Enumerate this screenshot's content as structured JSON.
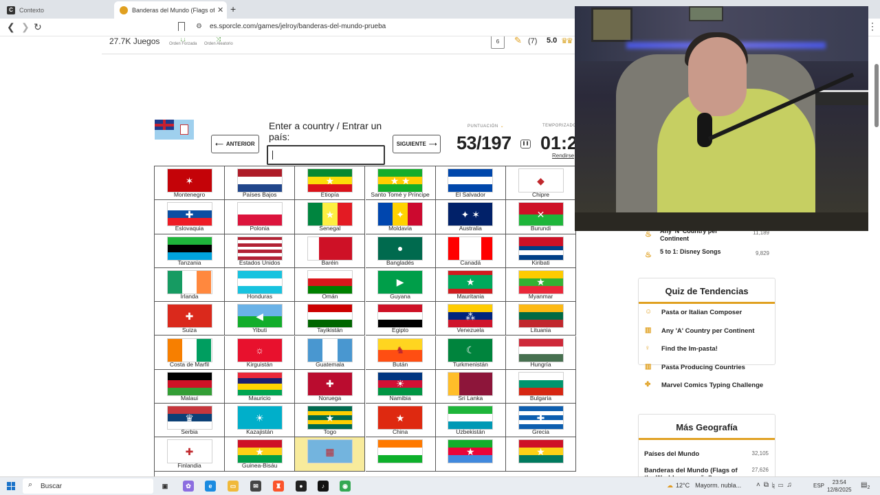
{
  "browser": {
    "tabs": [
      {
        "label": "Contexto",
        "icon": "C",
        "active": false
      },
      {
        "label": "Banderas del Mundo (Flags of the World en español)",
        "icon": "sporcle",
        "active": true
      }
    ],
    "url": "es.sporcle.com/games/jelroy/banderas-del-mundo-prueba"
  },
  "quiz_stats": {
    "plays": "27.7K Juegos",
    "order_forced": "Orden Forzada",
    "order_random": "Orden Aleatorio",
    "comments": "6",
    "ratings_count": "(7)",
    "rating": "5.0"
  },
  "quiz": {
    "answer_label": "Enter a country / Entrar un país:",
    "prev": "ANTERIOR",
    "next": "SIGUIENTE",
    "score_label": "PUNTUACIÓN",
    "score": "53/197",
    "timer_label": "TEMPORIZADOR",
    "timer": "01:2",
    "give_up": "Rendirse"
  },
  "flags": [
    {
      "name": "Montenegro",
      "colors": [
        "#c40308",
        "#c40308"
      ],
      "mark": "✶",
      "dir": "h"
    },
    {
      "name": "Países Bajos",
      "colors": [
        "#ae1c28",
        "#ffffff",
        "#21468b"
      ],
      "dir": "h"
    },
    {
      "name": "Etiopía",
      "colors": [
        "#078930",
        "#fcdd09",
        "#da121a"
      ],
      "mark": "★",
      "dir": "h"
    },
    {
      "name": "Santo Tomé y Príncipe",
      "colors": [
        "#12ad2b",
        "#ffce00",
        "#12ad2b"
      ],
      "mark": "★ ★",
      "dir": "h"
    },
    {
      "name": "El Salvador",
      "colors": [
        "#0047ab",
        "#ffffff",
        "#0047ab"
      ],
      "dir": "h"
    },
    {
      "name": "Chipre",
      "colors": [
        "#ffffff"
      ],
      "mark": "◆",
      "dir": "h"
    },
    {
      "name": "Eslovaquia",
      "colors": [
        "#ffffff",
        "#0b4ea2",
        "#ee1c25"
      ],
      "mark": "✚",
      "dir": "h"
    },
    {
      "name": "Polonia",
      "colors": [
        "#ffffff",
        "#dc143c"
      ],
      "dir": "h"
    },
    {
      "name": "Senegal",
      "colors": [
        "#00853f",
        "#fdef42",
        "#e31b23"
      ],
      "mark": "★",
      "dir": "v"
    },
    {
      "name": "Moldavia",
      "colors": [
        "#0046ae",
        "#ffd200",
        "#cc092f"
      ],
      "mark": "✦",
      "dir": "v"
    },
    {
      "name": "Australia",
      "colors": [
        "#012169",
        "#012169"
      ],
      "mark": "✦ ✶",
      "dir": "h"
    },
    {
      "name": "Burundi",
      "colors": [
        "#ce1126",
        "#1eb53a"
      ],
      "mark": "✕",
      "dir": "h"
    },
    {
      "name": "Tanzania",
      "colors": [
        "#1eb53a",
        "#000000",
        "#00a3dd"
      ],
      "dir": "h"
    },
    {
      "name": "Estados Unidos",
      "colors": [
        "#b22234",
        "#ffffff",
        "#b22234",
        "#ffffff",
        "#b22234",
        "#ffffff",
        "#b22234"
      ],
      "dir": "h"
    },
    {
      "name": "Baréin",
      "colors": [
        "#ffffff",
        "#ce1126",
        "#ce1126",
        "#ce1126"
      ],
      "dir": "v"
    },
    {
      "name": "Bangladés",
      "colors": [
        "#006a4e"
      ],
      "mark": "●",
      "dir": "h"
    },
    {
      "name": "Canadá",
      "colors": [
        "#ff0000",
        "#ffffff",
        "#ffffff",
        "#ff0000"
      ],
      "mark": "✦",
      "dir": "v"
    },
    {
      "name": "Kiribati",
      "colors": [
        "#ce1126",
        "#ce1126",
        "#003f87",
        "#ffffff",
        "#003f87"
      ],
      "dir": "h"
    },
    {
      "name": "Irlanda",
      "colors": [
        "#169b62",
        "#ffffff",
        "#ff883e"
      ],
      "dir": "v"
    },
    {
      "name": "Honduras",
      "colors": [
        "#18c3df",
        "#ffffff",
        "#18c3df"
      ],
      "mark": "∴",
      "dir": "h"
    },
    {
      "name": "Omán",
      "colors": [
        "#ffffff",
        "#db161b",
        "#008000"
      ],
      "dir": "h"
    },
    {
      "name": "Guyana",
      "colors": [
        "#009e49"
      ],
      "mark": "▶",
      "dir": "h"
    },
    {
      "name": "Mauritania",
      "colors": [
        "#d01c1f",
        "#00a95c",
        "#00a95c",
        "#00a95c",
        "#d01c1f"
      ],
      "mark": "★",
      "dir": "h"
    },
    {
      "name": "Myanmar",
      "colors": [
        "#fecb00",
        "#34b233",
        "#ea2839"
      ],
      "mark": "★",
      "dir": "h"
    },
    {
      "name": "Suiza",
      "colors": [
        "#da291c"
      ],
      "mark": "✚",
      "dir": "h"
    },
    {
      "name": "Yibuti",
      "colors": [
        "#6ab2e7",
        "#12ad2b"
      ],
      "mark": "◀",
      "dir": "h"
    },
    {
      "name": "Tayikistán",
      "colors": [
        "#cc0000",
        "#ffffff",
        "#006600"
      ],
      "mark": "♔",
      "dir": "h"
    },
    {
      "name": "Egipto",
      "colors": [
        "#ce1126",
        "#ffffff",
        "#000000"
      ],
      "mark": "♦",
      "dir": "h"
    },
    {
      "name": "Venezuela",
      "colors": [
        "#ffcc00",
        "#00247d",
        "#cf142b"
      ],
      "mark": "⁂",
      "dir": "h"
    },
    {
      "name": "Lituania",
      "colors": [
        "#fdb913",
        "#006a44",
        "#c1272d"
      ],
      "dir": "h"
    },
    {
      "name": "Costa de Marfil",
      "colors": [
        "#f77f00",
        "#ffffff",
        "#009e60"
      ],
      "dir": "v"
    },
    {
      "name": "Kirguistán",
      "colors": [
        "#e8112d"
      ],
      "mark": "☼",
      "dir": "h"
    },
    {
      "name": "Guatemala",
      "colors": [
        "#4997d0",
        "#ffffff",
        "#4997d0"
      ],
      "mark": "❦",
      "dir": "v"
    },
    {
      "name": "Bután",
      "colors": [
        "#ffd520",
        "#ff4e12"
      ],
      "mark": "♞",
      "dir": "h"
    },
    {
      "name": "Turkmenistán",
      "colors": [
        "#00843d"
      ],
      "mark": "☾",
      "dir": "h"
    },
    {
      "name": "Hungría",
      "colors": [
        "#ce2939",
        "#ffffff",
        "#477050"
      ],
      "dir": "h"
    },
    {
      "name": "Malaui",
      "colors": [
        "#000000",
        "#ce1126",
        "#339e35"
      ],
      "dir": "h"
    },
    {
      "name": "Mauricio",
      "colors": [
        "#ea2839",
        "#1a206d",
        "#ffd500",
        "#00a551"
      ],
      "dir": "h"
    },
    {
      "name": "Noruega",
      "colors": [
        "#ba0c2f"
      ],
      "mark": "✚",
      "dir": "h"
    },
    {
      "name": "Namibia",
      "colors": [
        "#003580",
        "#d21034",
        "#009543"
      ],
      "mark": "☀",
      "dir": "h"
    },
    {
      "name": "Sri Lanka",
      "colors": [
        "#ffbe29",
        "#8d153a",
        "#8d153a",
        "#8d153a"
      ],
      "dir": "v"
    },
    {
      "name": "Bulgaria",
      "colors": [
        "#ffffff",
        "#00966e",
        "#d62612"
      ],
      "dir": "h"
    },
    {
      "name": "Serbia",
      "colors": [
        "#c6363c",
        "#0c4076",
        "#ffffff"
      ],
      "mark": "♛",
      "dir": "h"
    },
    {
      "name": "Kazajistán",
      "colors": [
        "#00afca"
      ],
      "mark": "☀",
      "dir": "h"
    },
    {
      "name": "Togo",
      "colors": [
        "#006a4e",
        "#ffce00",
        "#006a4e",
        "#ffce00",
        "#006a4e"
      ],
      "mark": "★",
      "dir": "h"
    },
    {
      "name": "China",
      "colors": [
        "#de2910"
      ],
      "mark": "★",
      "dir": "h"
    },
    {
      "name": "Uzbekistán",
      "colors": [
        "#1eb53a",
        "#ffffff",
        "#0099b5"
      ],
      "dir": "h"
    },
    {
      "name": "Grecia",
      "colors": [
        "#0d5eaf",
        "#ffffff",
        "#0d5eaf",
        "#ffffff",
        "#0d5eaf"
      ],
      "mark": "✚",
      "dir": "h"
    },
    {
      "name": "Finlandia",
      "colors": [
        "#ffffff"
      ],
      "mark": "✚",
      "dir": "h"
    },
    {
      "name": "Guinea-Bisáu",
      "colors": [
        "#ce1126",
        "#fcd116",
        "#009e49"
      ],
      "mark": "★",
      "dir": "h"
    },
    {
      "name": "",
      "colors": [
        "#73b4de"
      ],
      "mark": "▦",
      "dir": "h",
      "highlight": true
    },
    {
      "name": "",
      "colors": [
        "#ff7900",
        "#ffffff",
        "#0db02b"
      ],
      "mark": "●",
      "dir": "h"
    },
    {
      "name": "",
      "colors": [
        "#12ad2b",
        "#ea0437",
        "#4189dd"
      ],
      "mark": "★",
      "dir": "h"
    },
    {
      "name": "",
      "colors": [
        "#ce1126",
        "#fcd116",
        "#007a5e"
      ],
      "mark": "★",
      "dir": "h"
    }
  ],
  "sidebar": {
    "top_items": [
      {
        "title": "Any 'N' Country per Continent",
        "count": "11,189"
      },
      {
        "title": "5 to 1: Disney Songs",
        "count": "9,829"
      }
    ],
    "trending_title": "Quiz de Tendencias",
    "trending": [
      "Pasta or Italian Composer",
      "Any 'A' Country per Continent",
      "Find the Im-pasta!",
      "Pasta Producing Countries",
      "Marvel Comics Typing Challenge"
    ],
    "geo_title": "Más Geografía",
    "geo": [
      {
        "title": "Países del Mundo",
        "count": "32,105"
      },
      {
        "title": "Banderas del Mundo (Flags of the World en español)",
        "count": "27,626"
      }
    ]
  },
  "taskbar": {
    "search": "Buscar",
    "weather_temp": "12°C",
    "weather_desc": "Mayorm. nubla...",
    "lang": "ESP",
    "time": "23:54",
    "date": "12/8/2025",
    "notifications": "2"
  }
}
